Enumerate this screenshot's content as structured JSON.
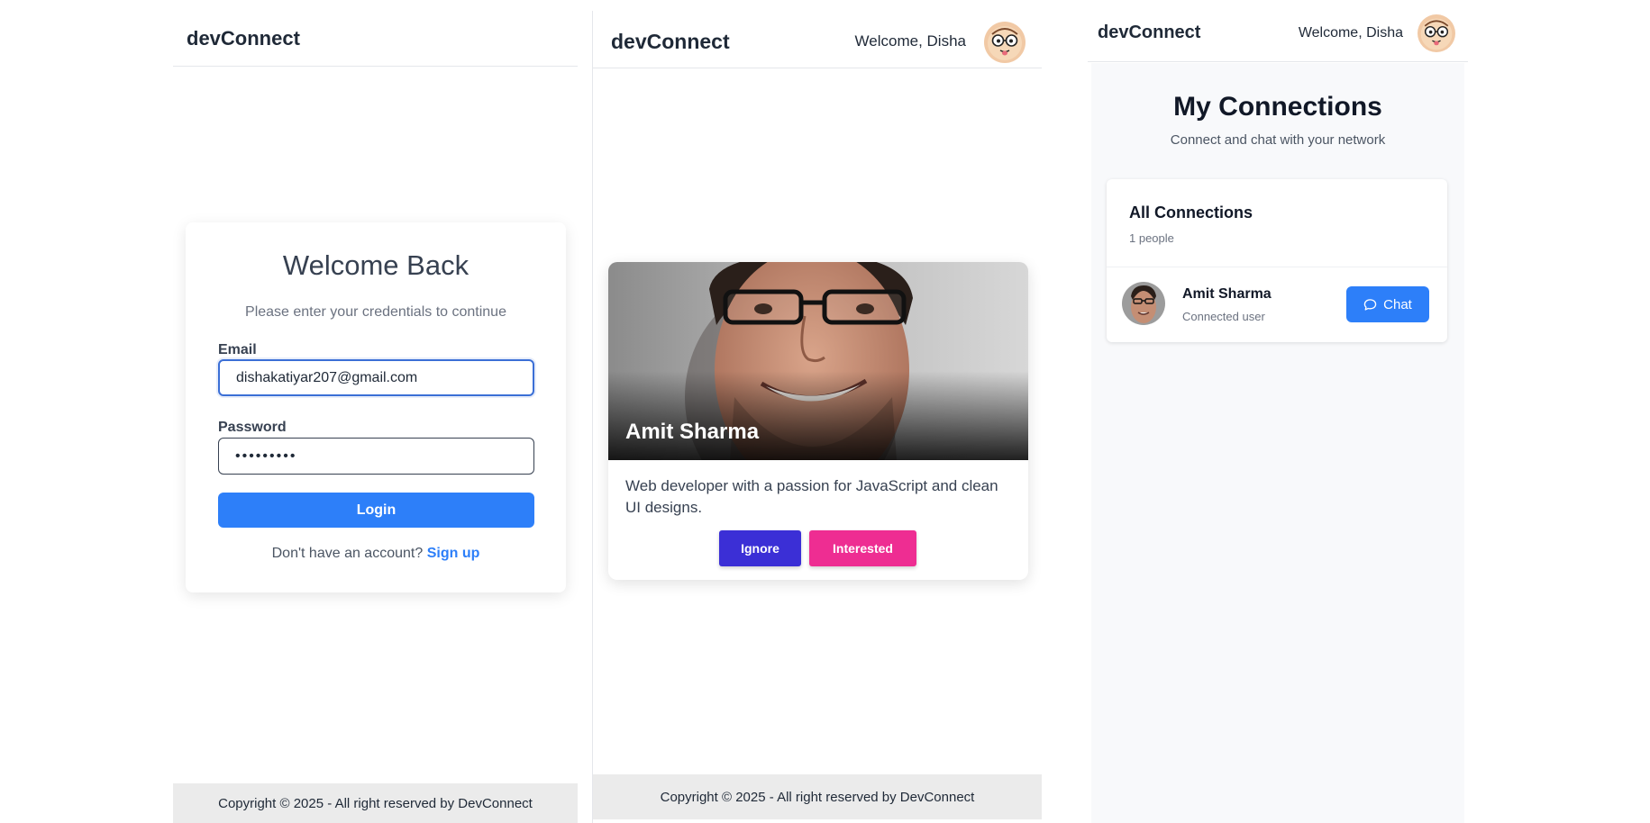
{
  "login_panel": {
    "brand": "devConnect",
    "title": "Welcome Back",
    "subtitle": "Please enter your credentials to continue",
    "email_label": "Email",
    "email_value": "dishakatiyar207@gmail.com",
    "password_label": "Password",
    "password_value": "•••••••••",
    "login_button": "Login",
    "signup_prompt": "Don't have an account?",
    "signup_link": "Sign up",
    "footer": "Copyright © 2025 - All right reserved by DevConnect"
  },
  "feed_panel": {
    "brand": "devConnect",
    "welcome": "Welcome, Disha",
    "card": {
      "name": "Amit Sharma",
      "bio": "Web developer with a passion for JavaScript and clean UI designs.",
      "ignore_button": "Ignore",
      "interested_button": "Interested"
    },
    "footer": "Copyright © 2025 - All right reserved by DevConnect"
  },
  "connections_panel": {
    "brand": "devConnect",
    "welcome": "Welcome, Disha",
    "title": "My Connections",
    "subtitle": "Connect and chat with your network",
    "card_title": "All Connections",
    "count": "1 people",
    "connection": {
      "name": "Amit Sharma",
      "status": "Connected user",
      "chat_button": "Chat"
    }
  },
  "colors": {
    "primary": "#2d7ff9",
    "ignore": "#3b2fd6",
    "interested": "#ee2d92",
    "footer_bg": "#ebebeb"
  },
  "icons": [
    "user-avatar-icon",
    "chat-bubble-icon"
  ]
}
